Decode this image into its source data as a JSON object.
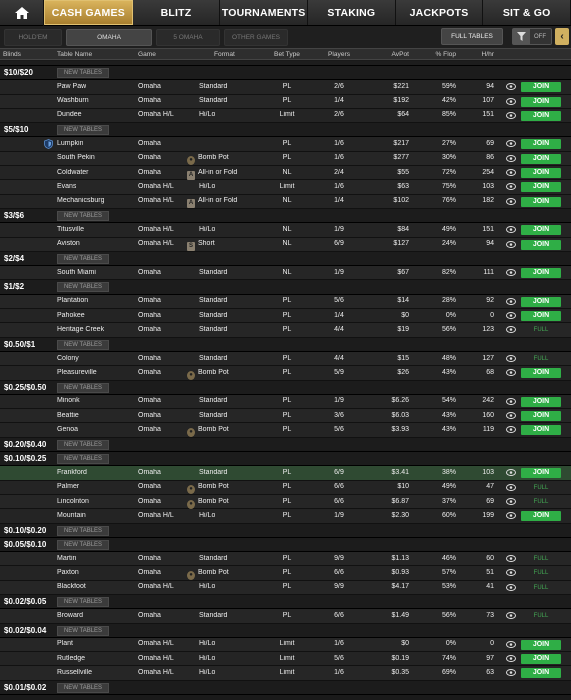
{
  "top_nav": {
    "home_icon": "home-icon",
    "tabs": [
      {
        "label": "CASH GAMES",
        "active": true
      },
      {
        "label": "BLITZ",
        "active": false
      },
      {
        "label": "TOURNAMENTS",
        "active": false
      },
      {
        "label": "STAKING",
        "active": false
      },
      {
        "label": "JACKPOTS",
        "active": false
      },
      {
        "label": "SIT & GO",
        "active": false
      }
    ]
  },
  "sub_nav": {
    "tabs": [
      {
        "label": "HOLD'EM",
        "active": false
      },
      {
        "label": "OMAHA",
        "active": true
      },
      {
        "label": "5 OMAHA",
        "active": false
      },
      {
        "label": "OTHER GAMES",
        "active": false
      }
    ],
    "full_tables_label": "FULL TABLES",
    "filter_icon": "filter-icon",
    "filter_state": "OFF",
    "collapse_icon": "chevron-left-icon"
  },
  "columns": {
    "blinds": "Blinds",
    "table_name": "Table Name",
    "game": "Game",
    "format": "Format",
    "bet_type": "Bet Type",
    "players": "Players",
    "avpot": "AvPot",
    "flop": "% Flop",
    "hhr": "H/hr"
  },
  "new_tables_label": "NEW TABLES",
  "join_label": "JOIN",
  "full_label": "FULL",
  "groups": [
    {
      "blinds": "$10/$20",
      "rows": [
        {
          "name": "Paw Paw",
          "game": "Omaha",
          "format": "Standard",
          "badge": "",
          "bet": "PL",
          "players": "2/6",
          "avpot": "$221",
          "flop": "59%",
          "hhr": "94",
          "action": "JOIN"
        },
        {
          "name": "Washburn",
          "game": "Omaha",
          "format": "Standard",
          "badge": "",
          "bet": "PL",
          "players": "1/4",
          "avpot": "$192",
          "flop": "42%",
          "hhr": "107",
          "action": "JOIN"
        },
        {
          "name": "Dundee",
          "game": "Omaha H/L",
          "format": "Hi/Lo",
          "badge": "",
          "bet": "Limit",
          "players": "2/6",
          "avpot": "$64",
          "flop": "85%",
          "hhr": "151",
          "action": "JOIN"
        }
      ]
    },
    {
      "blinds": "$5/$10",
      "rows": [
        {
          "name": "Lumpkin",
          "game": "Omaha",
          "format": "",
          "badge": "",
          "bet": "PL",
          "players": "1/6",
          "avpot": "$217",
          "flop": "27%",
          "hhr": "69",
          "action": "JOIN",
          "shield": true
        },
        {
          "name": "South Pekin",
          "game": "Omaha",
          "format": "Bomb Pot",
          "badge": "bomb",
          "bet": "PL",
          "players": "1/6",
          "avpot": "$277",
          "flop": "30%",
          "hhr": "86",
          "action": "JOIN"
        },
        {
          "name": "Coldwater",
          "game": "Omaha",
          "format": "All-in or Fold",
          "badge": "A",
          "bet": "NL",
          "players": "2/4",
          "avpot": "$55",
          "flop": "72%",
          "hhr": "254",
          "action": "JOIN"
        },
        {
          "name": "Evans",
          "game": "Omaha H/L",
          "format": "Hi/Lo",
          "badge": "",
          "bet": "Limit",
          "players": "1/6",
          "avpot": "$63",
          "flop": "75%",
          "hhr": "103",
          "action": "JOIN"
        },
        {
          "name": "Mechanicsburg",
          "game": "Omaha H/L",
          "format": "All-in or Fold",
          "badge": "A",
          "bet": "NL",
          "players": "1/4",
          "avpot": "$102",
          "flop": "76%",
          "hhr": "182",
          "action": "JOIN"
        }
      ]
    },
    {
      "blinds": "$3/$6",
      "rows": [
        {
          "name": "Titusville",
          "game": "Omaha H/L",
          "format": "Hi/Lo",
          "badge": "",
          "bet": "NL",
          "players": "1/9",
          "avpot": "$84",
          "flop": "49%",
          "hhr": "151",
          "action": "JOIN"
        },
        {
          "name": "Aviston",
          "game": "Omaha H/L",
          "format": "Short",
          "badge": "S",
          "bet": "NL",
          "players": "6/9",
          "avpot": "$127",
          "flop": "24%",
          "hhr": "94",
          "action": "JOIN"
        }
      ]
    },
    {
      "blinds": "$2/$4",
      "rows": [
        {
          "name": "South Miami",
          "game": "Omaha",
          "format": "Standard",
          "badge": "",
          "bet": "NL",
          "players": "1/9",
          "avpot": "$67",
          "flop": "82%",
          "hhr": "111",
          "action": "JOIN"
        }
      ]
    },
    {
      "blinds": "$1/$2",
      "rows": [
        {
          "name": "Plantation",
          "game": "Omaha",
          "format": "Standard",
          "badge": "",
          "bet": "PL",
          "players": "5/6",
          "avpot": "$14",
          "flop": "28%",
          "hhr": "92",
          "action": "JOIN"
        },
        {
          "name": "Pahokee",
          "game": "Omaha",
          "format": "Standard",
          "badge": "",
          "bet": "PL",
          "players": "1/4",
          "avpot": "$0",
          "flop": "0%",
          "hhr": "0",
          "action": "JOIN"
        },
        {
          "name": "Heritage Creek",
          "game": "Omaha",
          "format": "Standard",
          "badge": "",
          "bet": "PL",
          "players": "4/4",
          "avpot": "$19",
          "flop": "56%",
          "hhr": "123",
          "action": "FULL"
        }
      ]
    },
    {
      "blinds": "$0.50/$1",
      "rows": [
        {
          "name": "Colony",
          "game": "Omaha",
          "format": "Standard",
          "badge": "",
          "bet": "PL",
          "players": "4/4",
          "avpot": "$15",
          "flop": "48%",
          "hhr": "127",
          "action": "FULL"
        },
        {
          "name": "Pleasureville",
          "game": "Omaha",
          "format": "Bomb Pot",
          "badge": "bomb",
          "bet": "PL",
          "players": "5/9",
          "avpot": "$26",
          "flop": "43%",
          "hhr": "68",
          "action": "JOIN"
        }
      ]
    },
    {
      "blinds": "$0.25/$0.50",
      "rows": [
        {
          "name": "Minonk",
          "game": "Omaha",
          "format": "Standard",
          "badge": "",
          "bet": "PL",
          "players": "1/9",
          "avpot": "$6.26",
          "flop": "54%",
          "hhr": "242",
          "action": "JOIN"
        },
        {
          "name": "Beattie",
          "game": "Omaha",
          "format": "Standard",
          "badge": "",
          "bet": "PL",
          "players": "3/6",
          "avpot": "$6.03",
          "flop": "43%",
          "hhr": "160",
          "action": "JOIN"
        },
        {
          "name": "Genoa",
          "game": "Omaha",
          "format": "Bomb Pot",
          "badge": "bomb",
          "bet": "PL",
          "players": "5/6",
          "avpot": "$3.93",
          "flop": "43%",
          "hhr": "119",
          "action": "JOIN"
        }
      ]
    },
    {
      "blinds": "$0.20/$0.40",
      "rows": []
    },
    {
      "blinds": "$0.10/$0.25",
      "rows": [
        {
          "name": "Frankford",
          "game": "Omaha",
          "format": "Standard",
          "badge": "",
          "bet": "PL",
          "players": "6/9",
          "avpot": "$3.41",
          "flop": "38%",
          "hhr": "103",
          "action": "JOIN",
          "highlight": true
        },
        {
          "name": "Palmer",
          "game": "Omaha",
          "format": "Bomb Pot",
          "badge": "bomb",
          "bet": "PL",
          "players": "6/6",
          "avpot": "$10",
          "flop": "49%",
          "hhr": "47",
          "action": "FULL"
        },
        {
          "name": "Lincolnton",
          "game": "Omaha",
          "format": "Bomb Pot",
          "badge": "bomb",
          "bet": "PL",
          "players": "6/6",
          "avpot": "$6.87",
          "flop": "37%",
          "hhr": "69",
          "action": "FULL"
        },
        {
          "name": "Mountain",
          "game": "Omaha H/L",
          "format": "Hi/Lo",
          "badge": "",
          "bet": "PL",
          "players": "1/9",
          "avpot": "$2.30",
          "flop": "60%",
          "hhr": "199",
          "action": "JOIN"
        }
      ]
    },
    {
      "blinds": "$0.10/$0.20",
      "rows": []
    },
    {
      "blinds": "$0.05/$0.10",
      "rows": [
        {
          "name": "Martin",
          "game": "Omaha",
          "format": "Standard",
          "badge": "",
          "bet": "PL",
          "players": "9/9",
          "avpot": "$1.13",
          "flop": "46%",
          "hhr": "60",
          "action": "FULL"
        },
        {
          "name": "Paxton",
          "game": "Omaha",
          "format": "Bomb Pot",
          "badge": "bomb",
          "bet": "PL",
          "players": "6/6",
          "avpot": "$0.93",
          "flop": "57%",
          "hhr": "51",
          "action": "FULL"
        },
        {
          "name": "Blackfoot",
          "game": "Omaha H/L",
          "format": "Hi/Lo",
          "badge": "",
          "bet": "PL",
          "players": "9/9",
          "avpot": "$4.17",
          "flop": "53%",
          "hhr": "41",
          "action": "FULL"
        }
      ]
    },
    {
      "blinds": "$0.02/$0.05",
      "rows": [
        {
          "name": "Broward",
          "game": "Omaha",
          "format": "Standard",
          "badge": "",
          "bet": "PL",
          "players": "6/6",
          "avpot": "$1.49",
          "flop": "56%",
          "hhr": "73",
          "action": "FULL"
        }
      ]
    },
    {
      "blinds": "$0.02/$0.04",
      "rows": [
        {
          "name": "Plant",
          "game": "Omaha H/L",
          "format": "Hi/Lo",
          "badge": "",
          "bet": "Limit",
          "players": "1/6",
          "avpot": "$0",
          "flop": "0%",
          "hhr": "0",
          "action": "JOIN"
        },
        {
          "name": "Rutledge",
          "game": "Omaha H/L",
          "format": "Hi/Lo",
          "badge": "",
          "bet": "Limit",
          "players": "5/6",
          "avpot": "$0.19",
          "flop": "74%",
          "hhr": "97",
          "action": "JOIN"
        },
        {
          "name": "Russellville",
          "game": "Omaha H/L",
          "format": "Hi/Lo",
          "badge": "",
          "bet": "Limit",
          "players": "1/6",
          "avpot": "$0.35",
          "flop": "69%",
          "hhr": "63",
          "action": "JOIN"
        }
      ]
    },
    {
      "blinds": "$0.01/$0.02",
      "rows": []
    }
  ]
}
